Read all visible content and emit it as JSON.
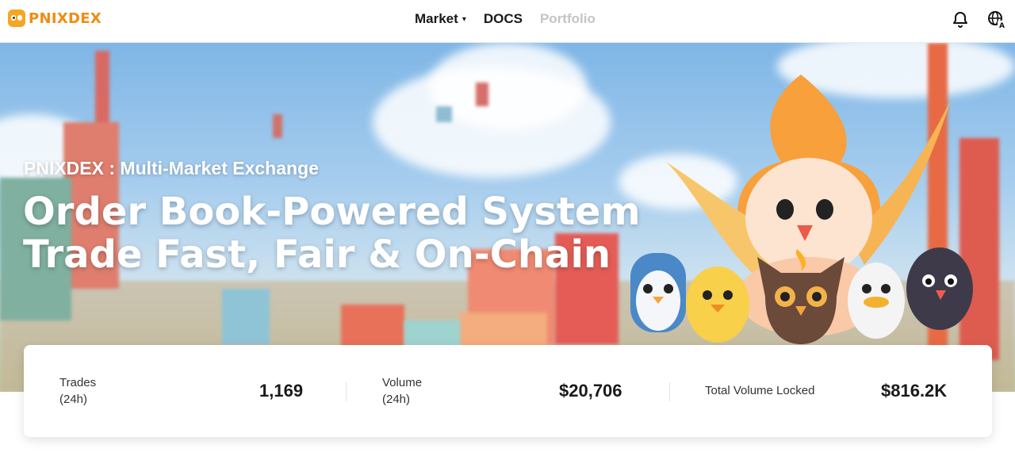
{
  "header": {
    "logo_text": "PNIXDEX",
    "nav": [
      {
        "label": "Market",
        "caret": "▾"
      },
      {
        "label": "DOCS"
      },
      {
        "label": "Portfolio"
      }
    ],
    "icons": [
      "bell-icon",
      "globe-language-icon"
    ]
  },
  "hero": {
    "subtitle": "PNIXDEX : Multi-Market Exchange",
    "title_line1": "Order Book-Powered System",
    "title_line2": "Trade Fast, Fair & On-Chain"
  },
  "stats": {
    "trades": {
      "label_line1": "Trades",
      "label_line2": "(24h)",
      "value": "1,169"
    },
    "volume": {
      "label_line1": "Volume",
      "label_line2": "(24h)",
      "value": "$20,706"
    },
    "tvl": {
      "label": "Total Volume Locked",
      "value": "$816.2K"
    }
  },
  "colors": {
    "brand": "#f08c14",
    "muted_nav": "#c4c4c4",
    "text": "#1a1a1a"
  }
}
